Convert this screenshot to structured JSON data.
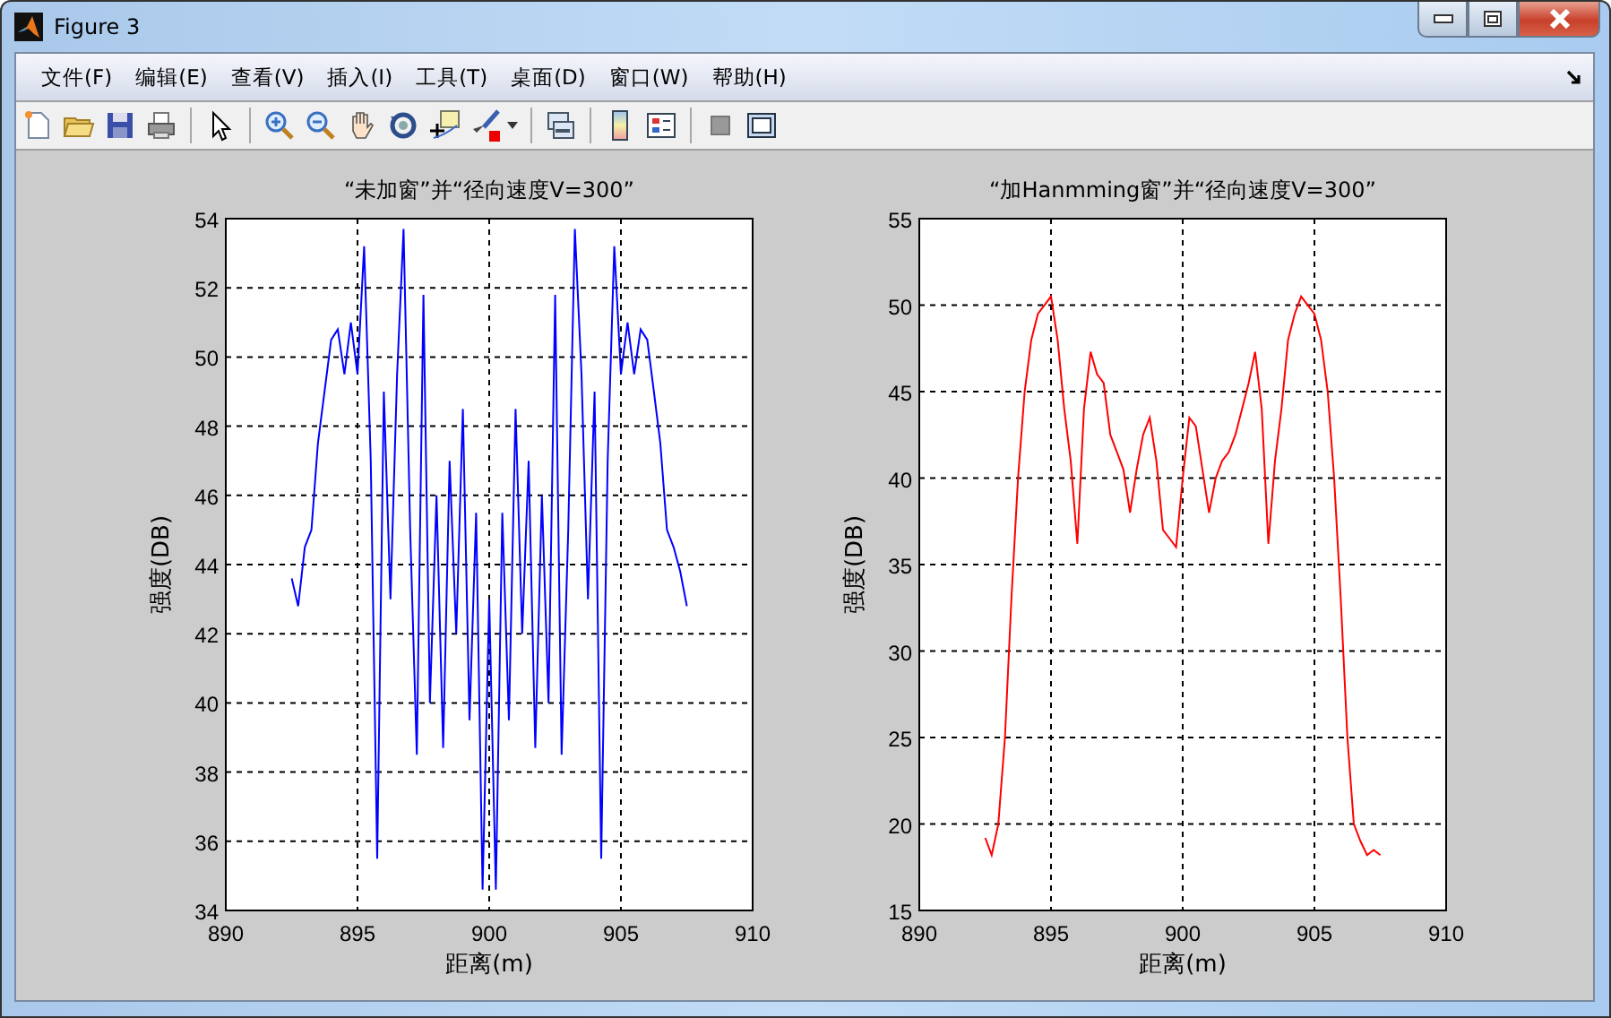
{
  "window": {
    "title": "Figure 3"
  },
  "menu": [
    {
      "label": "文件(F)"
    },
    {
      "label": "编辑(E)"
    },
    {
      "label": "查看(V)"
    },
    {
      "label": "插入(I)"
    },
    {
      "label": "工具(T)"
    },
    {
      "label": "桌面(D)"
    },
    {
      "label": "窗口(W)"
    },
    {
      "label": "帮助(H)"
    }
  ],
  "charts": [
    {
      "chart_data": {
        "type": "line",
        "grid": true,
        "title": "“未加窗”并“径向速度V=300”",
        "xlabel": "距离(m)",
        "ylabel": "强度(DB)",
        "xlim": [
          890,
          910
        ],
        "ylim": [
          34,
          54
        ],
        "xticks": [
          890,
          895,
          900,
          905,
          910
        ],
        "yticks": [
          34,
          36,
          38,
          40,
          42,
          44,
          46,
          48,
          50,
          52,
          54
        ],
        "x": [
          892.5,
          892.75,
          893,
          893.25,
          893.5,
          893.75,
          894,
          894.25,
          894.5,
          894.75,
          895,
          895.25,
          895.5,
          895.75,
          896,
          896.25,
          896.5,
          896.75,
          897,
          897.25,
          897.5,
          897.75,
          898,
          898.25,
          898.5,
          898.75,
          899,
          899.25,
          899.5,
          899.75,
          900,
          900.25,
          900.5,
          900.75,
          901,
          901.25,
          901.5,
          901.75,
          902,
          902.25,
          902.5,
          902.75,
          903,
          903.25,
          903.5,
          903.75,
          904,
          904.25,
          904.5,
          904.75,
          905,
          905.25,
          905.5,
          905.75,
          906,
          906.25,
          906.5,
          906.75,
          907,
          907.25,
          907.5
        ],
        "series": [
          {
            "color": "#0000ff",
            "values": [
              43.6,
              42.8,
              44.5,
              45,
              47.5,
              49,
              50.5,
              50.8,
              49.5,
              51,
              49.5,
              53.2,
              47,
              35.5,
              49,
              43,
              49.5,
              53.7,
              45,
              38.5,
              51.8,
              40,
              46,
              38.7,
              47,
              42,
              48.5,
              39.5,
              45.5,
              34.6,
              43,
              34.6,
              45.5,
              39.5,
              48.5,
              42,
              47,
              38.7,
              46,
              40,
              51.8,
              38.5,
              45,
              53.7,
              49.5,
              43,
              49,
              35.5,
              47,
              53.2,
              49.5,
              51,
              49.5,
              50.8,
              50.5,
              49,
              47.5,
              45,
              44.5,
              43.8,
              42.8
            ]
          }
        ]
      }
    },
    {
      "chart_data": {
        "type": "line",
        "grid": true,
        "title": "“加Hanmming窗”并“径向速度V=300”",
        "xlabel": "距离(m)",
        "ylabel": "强度(DB)",
        "xlim": [
          890,
          910
        ],
        "ylim": [
          15,
          55
        ],
        "xticks": [
          890,
          895,
          900,
          905,
          910
        ],
        "yticks": [
          15,
          20,
          25,
          30,
          35,
          40,
          45,
          50,
          55
        ],
        "x": [
          892.5,
          892.75,
          893,
          893.25,
          893.5,
          893.75,
          894,
          894.25,
          894.5,
          894.75,
          895,
          895.25,
          895.5,
          895.75,
          896,
          896.25,
          896.5,
          896.75,
          897,
          897.25,
          897.5,
          897.75,
          898,
          898.25,
          898.5,
          898.75,
          899,
          899.25,
          899.5,
          899.75,
          900,
          900.25,
          900.5,
          900.75,
          901,
          901.25,
          901.5,
          901.75,
          902,
          902.25,
          902.5,
          902.75,
          903,
          903.25,
          903.5,
          903.75,
          904,
          904.25,
          904.5,
          904.75,
          905,
          905.25,
          905.5,
          905.75,
          906,
          906.25,
          906.5,
          906.75,
          907,
          907.25,
          907.5
        ],
        "series": [
          {
            "color": "#ff0000",
            "values": [
              19.2,
              18.2,
              20,
              25,
              33,
              40,
              45,
              48,
              49.5,
              50,
              50.5,
              48,
              44,
              41,
              36.2,
              44,
              47.3,
              46,
              45.5,
              42.5,
              41.5,
              40.5,
              38,
              40.5,
              42.5,
              43.5,
              41,
              37,
              36.5,
              36,
              40,
              43.5,
              43,
              40.5,
              38,
              40,
              41,
              41.5,
              42.5,
              44,
              45.5,
              47.3,
              44,
              36.2,
              41,
              44,
              48,
              49.5,
              50.5,
              50,
              49.5,
              48,
              45,
              40,
              33,
              25,
              20,
              19,
              18.2,
              18.5,
              18.2
            ]
          }
        ]
      }
    }
  ]
}
